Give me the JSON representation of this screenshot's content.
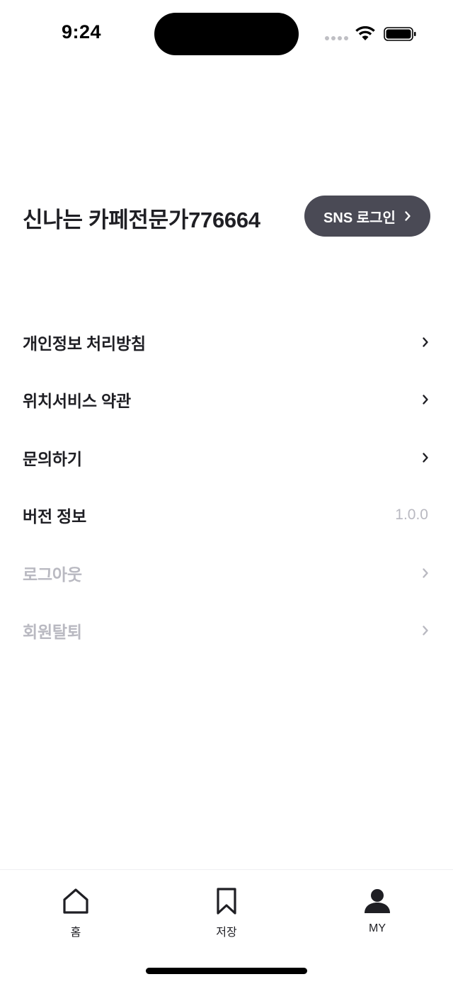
{
  "status_bar": {
    "time": "9:24"
  },
  "profile": {
    "name": "신나는 카페전문가776664",
    "sns_button_label": "SNS 로그인"
  },
  "menu": {
    "privacy": "개인정보 처리방침",
    "location_terms": "위치서비스 약관",
    "inquiry": "문의하기",
    "version_label": "버전 정보",
    "version_value": "1.0.0",
    "logout": "로그아웃",
    "withdraw": "회원탈퇴"
  },
  "tabbar": {
    "home": "홈",
    "saved": "저장",
    "my": "MY"
  },
  "colors": {
    "button_bg": "#4a4a55",
    "muted_text": "#b9b9c1",
    "primary_text": "#1f1f24"
  }
}
